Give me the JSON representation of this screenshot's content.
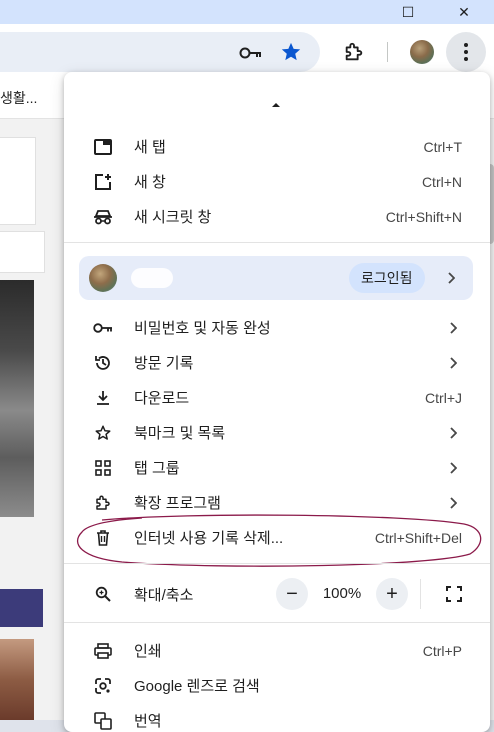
{
  "window": {
    "restore_glyph": "☐",
    "close_glyph": "✕"
  },
  "toolbar": {
    "key_icon": "key-icon",
    "star_icon": "star-filled-icon",
    "extensions_icon": "puzzle-icon",
    "menu_icon": "kebab-menu-icon",
    "accent": "#0b57d0"
  },
  "bookmarks": {
    "item_label": "생활..."
  },
  "menu": {
    "group1": [
      {
        "icon": "new-tab-icon",
        "label": "새 탭",
        "shortcut": "Ctrl+T"
      },
      {
        "icon": "new-window-icon",
        "label": "새 창",
        "shortcut": "Ctrl+N"
      },
      {
        "icon": "incognito-icon",
        "label": "새 시크릿 창",
        "shortcut": "Ctrl+Shift+N"
      }
    ],
    "profile": {
      "name": "",
      "signin_label": "로그인됨"
    },
    "group2": [
      {
        "icon": "key-icon",
        "label": "비밀번호 및 자동 완성"
      },
      {
        "icon": "history-icon",
        "label": "방문 기록"
      },
      {
        "icon": "download-icon",
        "label": "다운로드",
        "shortcut": "Ctrl+J"
      },
      {
        "icon": "star-icon",
        "label": "북마크 및 목록"
      },
      {
        "icon": "tab-groups-icon",
        "label": "탭 그룹"
      },
      {
        "icon": "extension-icon",
        "label": "확장 프로그램"
      },
      {
        "icon": "trash-icon",
        "label": "인터넷 사용 기록 삭제...",
        "shortcut": "Ctrl+Shift+Del"
      }
    ],
    "zoom": {
      "label": "확대/축소",
      "value": "100%",
      "minus": "−",
      "plus": "+"
    },
    "group3": [
      {
        "icon": "print-icon",
        "label": "인쇄",
        "shortcut": "Ctrl+P"
      },
      {
        "icon": "google-lens-icon",
        "label": "Google 렌즈로 검색"
      },
      {
        "icon": "translate-icon",
        "label": "번역"
      }
    ]
  }
}
